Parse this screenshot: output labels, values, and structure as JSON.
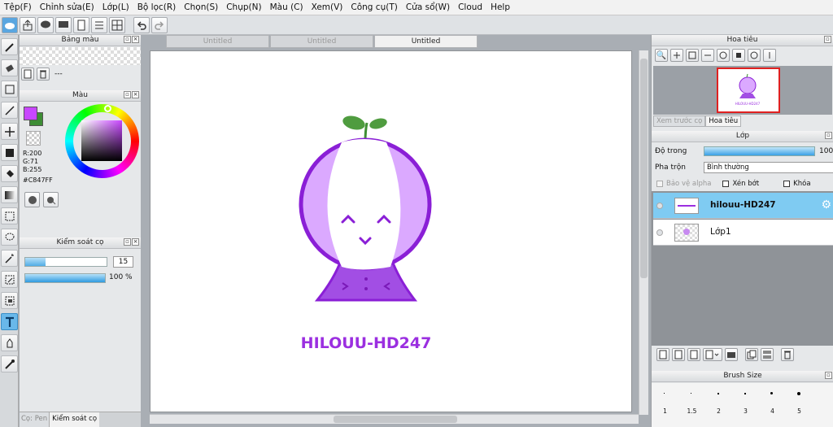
{
  "menu": [
    "Tệp(F)",
    "Chỉnh sửa(E)",
    "Lớp(L)",
    "Bộ lọc(R)",
    "Chọn(S)",
    "Chụp(N)",
    "Màu (C)",
    "Xem(V)",
    "Công cụ(T)",
    "Cửa sổ(W)",
    "Cloud",
    "Help"
  ],
  "tabs": [
    "Untitled",
    "Untitled",
    "Untitled"
  ],
  "palette": {
    "title": "Bảng màu",
    "empty": "---"
  },
  "color": {
    "title": "Màu",
    "r": "R:200",
    "g": "G:71",
    "b": "B:255",
    "hex": "#C847FF",
    "primary": "#c847ff",
    "secondary": "#3d8d35"
  },
  "brush_control": {
    "title": "Kiểm soát cọ",
    "size": "15",
    "size_level": 0.25,
    "opacity": "100 %",
    "opacity_level": 1.0
  },
  "left_tabs": {
    "pen": "Cọ: Pen",
    "brush_control": "Kiểm soát cọ"
  },
  "artwork": {
    "text": "HILOUU-HD247",
    "thumb_text": "HILOUU-HD247"
  },
  "navigator": {
    "title": "Hoa tiêu",
    "tab_preview": "Xem trước cọ",
    "tab_nav": "Hoa tiêu"
  },
  "layers": {
    "title": "Lớp",
    "opacity_label": "Độ trong",
    "opacity_value": "100",
    "blend_label": "Pha trộn",
    "blend_value": "Bình thường",
    "protect_alpha": "Bảo vệ alpha",
    "clip": "Xén bớt",
    "lock": "Khóa",
    "items": [
      {
        "name": "hilouu-HD247",
        "selected": true
      },
      {
        "name": "Lớp1",
        "selected": false
      }
    ]
  },
  "brush_size": {
    "title": "Brush Size",
    "sizes": [
      "1",
      "1.5",
      "2",
      "3",
      "4",
      "5"
    ]
  }
}
